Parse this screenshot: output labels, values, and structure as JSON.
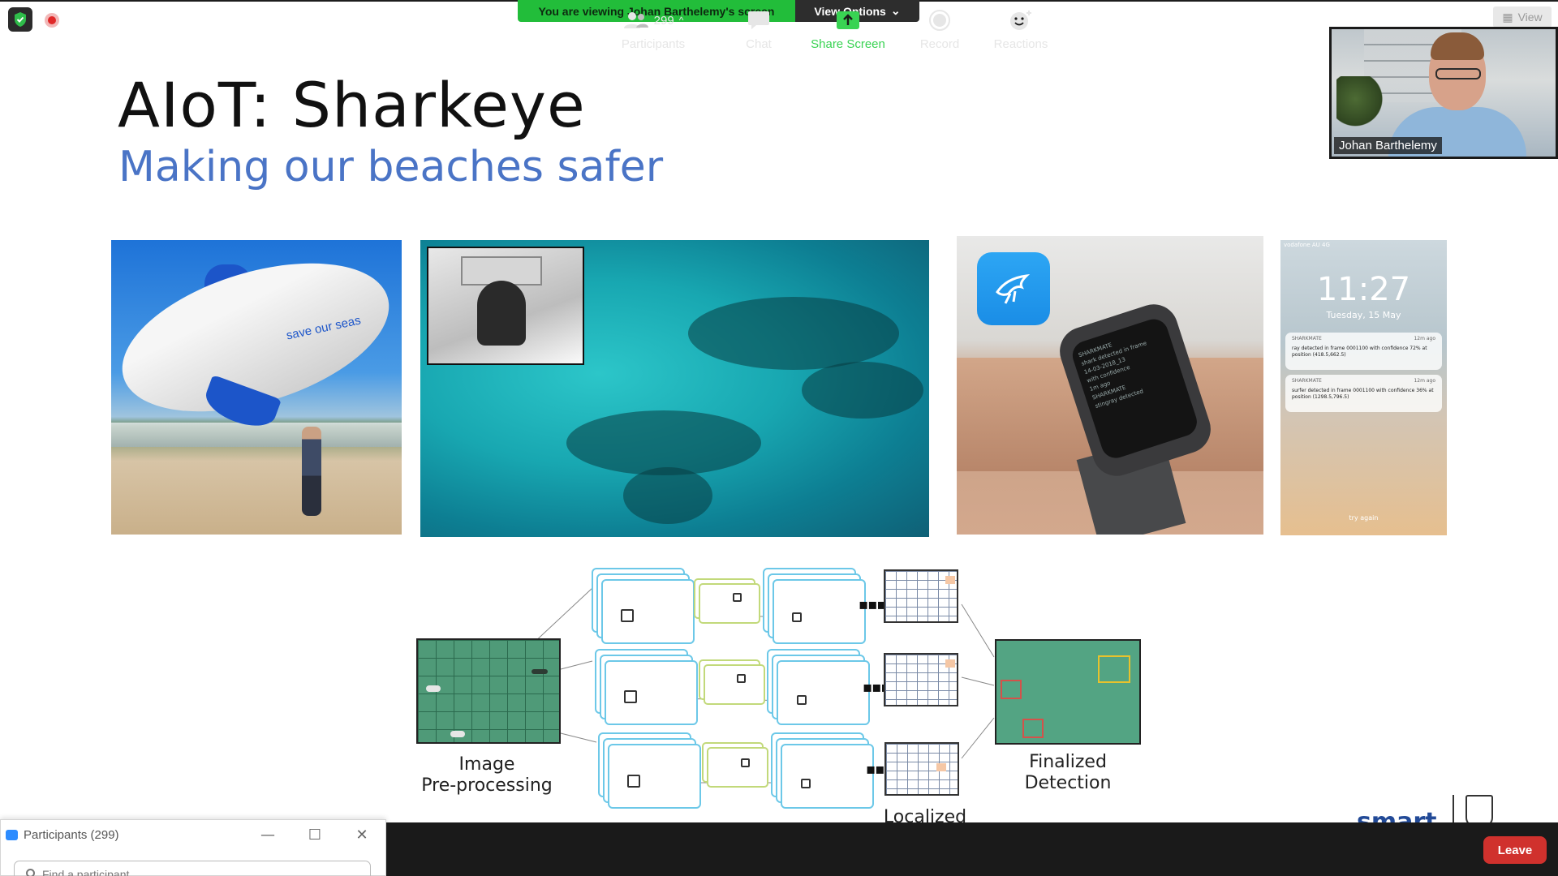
{
  "banner": {
    "viewing_text": "You are viewing Johan Barthelemy's screen",
    "view_options_label": "View Options",
    "view_label": "View"
  },
  "video": {
    "participant_name": "Johan Barthelemy"
  },
  "slide": {
    "title": "AIoT: Sharkeye",
    "subtitle": "Making our beaches safer",
    "blimp_text": "save our seas",
    "phone_clock": "11:27",
    "phone_date": "Tuesday, 15 May",
    "phone_carrier": "vodafone AU  4G",
    "notifications": [
      {
        "app": "SHARKMATE",
        "time": "12m ago",
        "text": "ray detected in frame 0001100 with confidence 72% at position (418.5,662.5)"
      },
      {
        "app": "SHARKMATE",
        "time": "12m ago",
        "text": "surfer detected in frame 0001100 with confidence 36% at position (1298.5,796.5)"
      }
    ],
    "phone_footer": "try again",
    "watch_lines": [
      "SHARKMATE",
      "shark detected in frame",
      "14-03-2018_13",
      "with confidence",
      "1m ago",
      "SHARKMATE",
      "stingray detected"
    ],
    "diagram": {
      "left_label_1": "Image",
      "left_label_2": "Pre-processing",
      "right_label_1": "Finalized",
      "right_label_2": "Detection",
      "bottom_label": "Localized"
    },
    "footer_logo_text": "smart"
  },
  "participants_panel": {
    "title": "Participants (299)",
    "search_placeholder": "Find a participant"
  },
  "toolbar": {
    "participants_count": "299",
    "participants_label": "Participants",
    "chat_label": "Chat",
    "share_label": "Share Screen",
    "record_label": "Record",
    "reactions_label": "Reactions",
    "leave_label": "Leave"
  },
  "colors": {
    "share_green": "#39d353",
    "leave_red": "#d0312d",
    "subtitle_blue": "#4a74c6",
    "banner_green": "#22bd3a"
  }
}
